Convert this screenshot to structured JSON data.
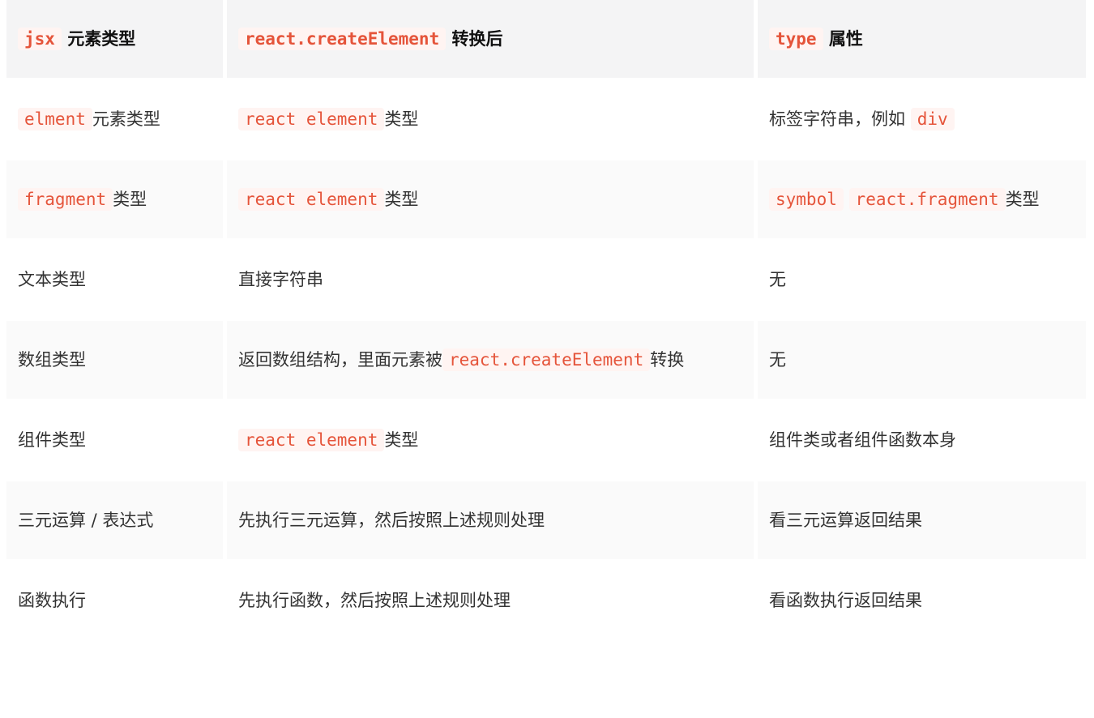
{
  "header": [
    {
      "code": "jsx",
      "text": "元素类型"
    },
    {
      "code": "react.createElement",
      "text": "转换后"
    },
    {
      "code": "type",
      "text": "属性"
    }
  ],
  "rows": [
    {
      "c1": {
        "code": "elment",
        "text": "元素类型"
      },
      "c2": {
        "code": "react element",
        "text": "类型"
      },
      "c3": {
        "text": "标签字符串，例如",
        "code": "div"
      }
    },
    {
      "c1": {
        "code": "fragment",
        "text": "类型"
      },
      "c2": {
        "code": "react element",
        "text": "类型"
      },
      "c3": {
        "code1": "symbol",
        "code2": "react.fragment",
        "text": "类型"
      }
    },
    {
      "c1": {
        "text": "文本类型"
      },
      "c2": {
        "text": "直接字符串"
      },
      "c3": {
        "text": "无"
      }
    },
    {
      "c1": {
        "text": "数组类型"
      },
      "c2": {
        "text": "返回数组结构，里面元素被",
        "code": "react.createElement",
        "text2": "转换"
      },
      "c3": {
        "text": "无"
      }
    },
    {
      "c1": {
        "text": "组件类型"
      },
      "c2": {
        "code": "react element",
        "text": "类型"
      },
      "c3": {
        "text": "组件类或者组件函数本身"
      }
    },
    {
      "c1": {
        "text": "三元运算 / 表达式"
      },
      "c2": {
        "text": "先执行三元运算，然后按照上述规则处理"
      },
      "c3": {
        "text": "看三元运算返回结果"
      }
    },
    {
      "c1": {
        "text": "函数执行"
      },
      "c2": {
        "text": "先执行函数，然后按照上述规则处理"
      },
      "c3": {
        "text": "看函数执行返回结果"
      }
    }
  ],
  "colors": {
    "code_text": "#e5543a",
    "code_bg": "#fff4f2",
    "header_bg": "#f4f4f5"
  }
}
